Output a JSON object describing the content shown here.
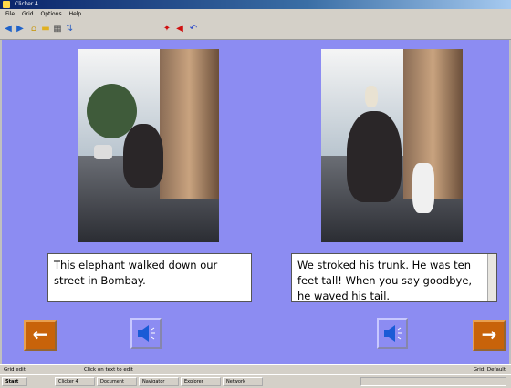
{
  "window": {
    "title": "Clicker 4"
  },
  "menu": [
    "File",
    "Grid",
    "Options",
    "Help"
  ],
  "toolbar": {
    "icons": [
      "back-arrow-icon",
      "forward-arrow-icon",
      "home-icon",
      "open-folder-icon",
      "grid-icon",
      "sort-icon",
      "red-arrow-icon",
      "red-back-icon",
      "blue-undo-icon"
    ]
  },
  "page": {
    "text_left": "This elephant walked down our street in Bombay.",
    "text_right": "We stroked his trunk. He was ten feet tall! When you say goodbye, he waved his tail.",
    "prev_label": "←",
    "next_label": "→"
  },
  "colors": {
    "stage": "#8c8cf2",
    "nav_button": "#c8630a"
  },
  "status": {
    "left": "Grid edit",
    "middle": "Click on text to edit",
    "right": "Grid: Default"
  },
  "taskbar": {
    "start": "Start",
    "tasks": [
      "Clicker 4",
      "Document",
      "Navigator",
      "Explorer",
      "Network"
    ],
    "clock": ""
  }
}
